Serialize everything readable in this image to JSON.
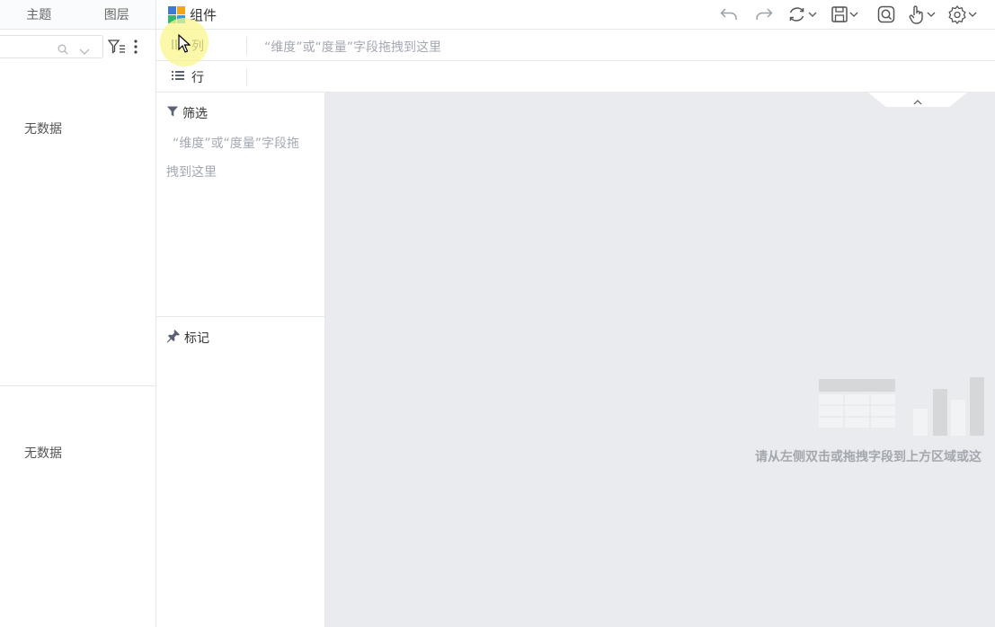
{
  "left_panel": {
    "tabs": [
      "主题",
      "图层"
    ],
    "search": {
      "value": "",
      "placeholder": ""
    },
    "empty_top": "无数据",
    "empty_bottom": "无数据"
  },
  "toolbar": {
    "title": "组件",
    "logo_colors": [
      "#3a7bd5",
      "#f2a516",
      "#2dba6a",
      "#1fa6d8"
    ],
    "buttons": [
      "undo-icon",
      "redo-icon",
      "refresh-icon",
      "save-icon",
      "preview-icon",
      "interaction-icon",
      "settings-icon"
    ]
  },
  "shelves": {
    "columns": {
      "label": "列",
      "hint": "“维度”或“度量”字段拖拽到这里"
    },
    "rows": {
      "label": "行"
    }
  },
  "filter_panel": {
    "title": "筛选",
    "hint": "“维度”或“度量”字段拖拽到这里"
  },
  "mark_panel": {
    "title": "标记"
  },
  "canvas": {
    "empty_text": "请从左侧双击或拖拽字段到上方区域或这"
  }
}
